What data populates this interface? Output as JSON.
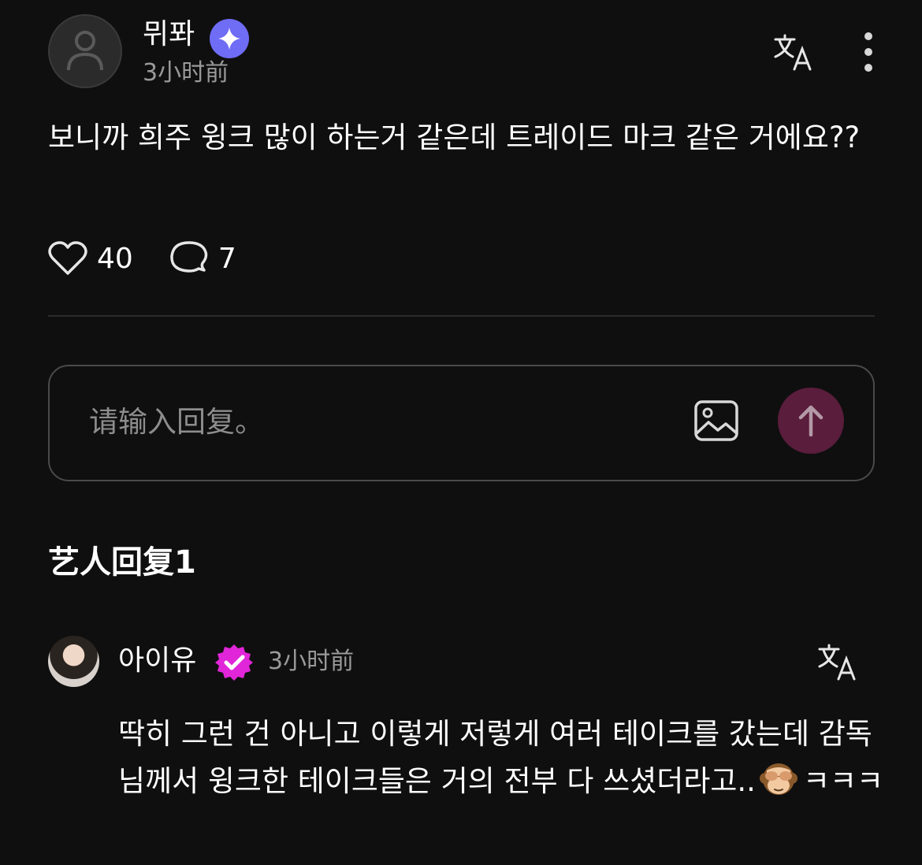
{
  "post": {
    "author": "뮈퐈",
    "time": "3小时前",
    "text": "보니까 희주 윙크 많이 하는거 같은데 트레이드 마크 같은 거에요??",
    "likes": "40",
    "comments": "7"
  },
  "reply_input": {
    "placeholder": "请输入回复。"
  },
  "artist_section": {
    "title": "艺人回复1"
  },
  "artist_reply": {
    "name": "아이유",
    "time": "3小时前",
    "text_before": "딱히 그런 건 아니고 이렇게 저렇게 여러 테이크를 갔는데 감독님께서 윙크한 테이크들은 거의 전부 다 쓰셨더라고..",
    "text_after": "ㅋㅋㅋ"
  },
  "colors": {
    "background": "#0f0f0f",
    "verified_blue": "#6f6cf6",
    "verified_pink": "#e026d8",
    "send_button": "#5a1d3c"
  },
  "icons": [
    "avatar-placeholder-icon",
    "verified-badge-icon",
    "translate-icon",
    "more-vertical-icon",
    "heart-icon",
    "comment-icon",
    "image-icon",
    "arrow-up-icon",
    "see-no-evil-monkey-emoji"
  ]
}
